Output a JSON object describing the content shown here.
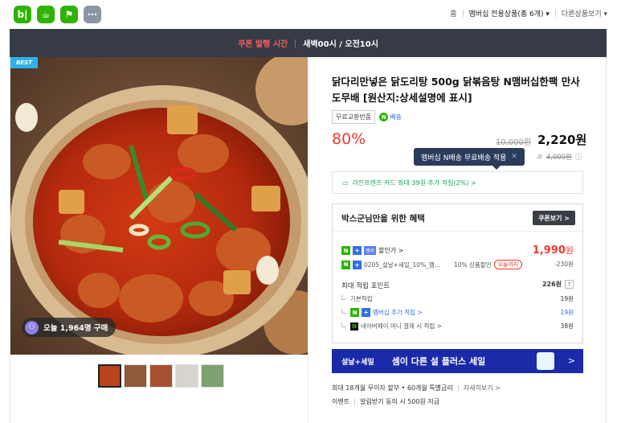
{
  "header": {
    "apps": [
      {
        "icon": "blog-icon",
        "glyph": "b|",
        "color": "#2db400"
      },
      {
        "icon": "cafe-icon",
        "glyph": "☕",
        "color": "#2db400"
      },
      {
        "icon": "bookmark-icon",
        "glyph": "⚑",
        "color": "#2db400"
      },
      {
        "icon": "more-apps-icon",
        "glyph": "⋯",
        "color": "#8b95a3"
      }
    ],
    "breadcrumb": {
      "home": "홈",
      "category": "멤버십 전용상품(총 6개)",
      "other": "다른상품보기"
    }
  },
  "banner": {
    "label": "쿠폰 발행 시간",
    "times": "새벽00시 / 오전10시"
  },
  "gallery": {
    "best_badge": "BEST",
    "purchase_count": "오늘 1,964명 구매"
  },
  "product": {
    "title": "닭다리만넣은 닭도리탕 500g 닭볶음탕 N맴버십한팩 만사도무배 [원산지:상세설명에 표시]",
    "tag_return": "무료교환반품",
    "tag_delivery": "배송",
    "discount_pct": "80%",
    "original_price": "10,000원",
    "final_price": "2,220원",
    "tooltip": "멤버십 N배송 무료배송 적용",
    "shipping_label": "ㄹ",
    "shipping_fee": "4,000원"
  },
  "card_offer": "라인프렌즈 카드 최대 39원 추가 적립(2%) >",
  "benefit": {
    "title": "박스군님만을 위한 혜택",
    "coupon_button": "쿠폰보기 >",
    "discount_label": "할인가 >",
    "discount_price": "1,990",
    "discount_unit": "원",
    "coupon_name": "0205_설날+세일_10%_멤...",
    "coupon_rate": "10% 상품할인",
    "coupon_tag": "오늘까지",
    "coupon_amount": "-230원",
    "points_label": "최대 적립 포인트",
    "points_total": "226원",
    "rows": [
      {
        "label": "기본적립",
        "value": "19원"
      },
      {
        "label": "멤버십 추가 적립 >",
        "value": "19원"
      },
      {
        "label": "네이버페이 머니 결제 시 적립 >",
        "value": "38원"
      }
    ]
  },
  "promo": {
    "tag": "설날+세일",
    "text": "셈이 다른 설 플러스 세일",
    "chevron": ">"
  },
  "info": {
    "installment": "최대 18개월 무이자 할부 • 60개월 특별금리",
    "installment_link": "자세히보기 >",
    "event_label": "이벤트",
    "event_text": "알림받기 동의 시 500원 지급"
  },
  "colors": {
    "accent_red": "#f0392b",
    "naver_green": "#2db400",
    "promo_blue": "#1a2aa8",
    "banner_dark": "#363b45"
  }
}
